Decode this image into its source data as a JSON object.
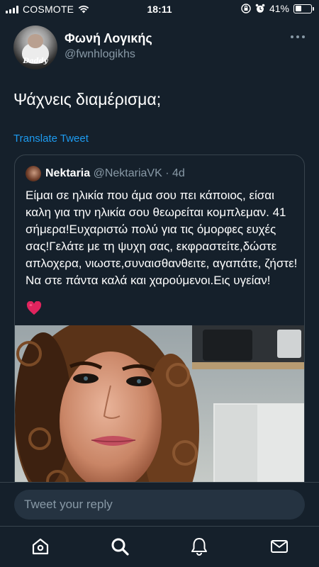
{
  "status_bar": {
    "carrier": "COSMOTE",
    "time": "18:11",
    "battery_percent": "41%",
    "battery_level": 0.41,
    "icons": [
      "signal-icon",
      "wifi-icon",
      "orientation-lock-icon",
      "alarm-icon",
      "battery-icon"
    ]
  },
  "tweet": {
    "author_name": "Φωνή Λογικής",
    "author_handle": "@fwnhlogikhs",
    "avatar_caption": "Daddy",
    "text": "Ψάχνεις διαμέρισμα;",
    "translate_label": "Translate Tweet"
  },
  "quoted_tweet": {
    "author_name": "Nektaria",
    "author_handle": "@NektariaVK",
    "separator": "·",
    "time": "4d",
    "text": "Είμαι σε ηλικία που άμα σου πει κάποιος, είσαι καλη για την ηλικία σου θεωρείται κομπλεμαν. 41 σήμερα!Ευχαριστώ πολύ για τις όμορφες ευχές σας!Γελάτε με τη ψυχη σας, εκφραστείτε,δώστε απλοχερα, νιωστε,συναισθανθειτε, αγαπάτε, ζήστε! Να στε πάντα καλά και χαρούμενοι.Εις υγείαν!",
    "emoji": "red-heart-icon",
    "image": "selfie-photo"
  },
  "reply": {
    "placeholder": "Tweet your reply"
  },
  "tab_bar": {
    "items": [
      "home-icon",
      "search-icon",
      "notifications-icon",
      "messages-icon"
    ]
  },
  "colors": {
    "background": "#15202b",
    "accent": "#1d9bf0",
    "secondary_text": "#8899a6",
    "border": "#38444d",
    "heart": "#e0245e"
  }
}
